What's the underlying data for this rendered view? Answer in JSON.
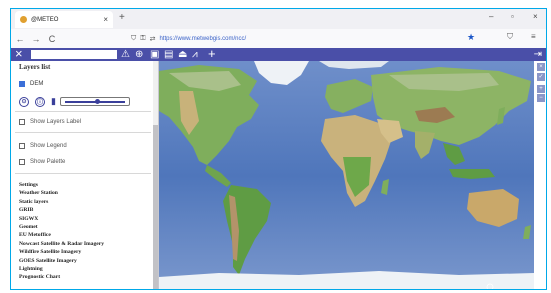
{
  "browser": {
    "tab_title": "@METEO",
    "tab_close": "×",
    "new_tab": "+",
    "nav": {
      "back": "←",
      "forward": "→",
      "reload": "C"
    },
    "url_icons": [
      "shield-icon",
      "lock-icon"
    ],
    "url": "https://www.metwebgis.com/ncc/",
    "window_controls": {
      "minimize": "–",
      "restore": "▫",
      "close": "×"
    },
    "right_icons": {
      "shield": "⛉",
      "menu": "≡"
    }
  },
  "app_toolbar": {
    "close": "×",
    "search_placeholder": "",
    "icons": [
      {
        "name": "alert-icon",
        "glyph": "⚠"
      },
      {
        "name": "globe-icon",
        "glyph": "⊕"
      },
      {
        "name": "window-icon",
        "glyph": "▣"
      },
      {
        "name": "clipboard-icon",
        "glyph": "▤"
      },
      {
        "name": "upload-icon",
        "glyph": "⏏"
      },
      {
        "name": "chart-icon",
        "glyph": "⩘"
      },
      {
        "name": "plus-icon",
        "glyph": "+"
      }
    ],
    "exit_icon": "⇥"
  },
  "side_panel": {
    "title": "Layers list",
    "layer": {
      "label": "DEM",
      "checked": true
    },
    "controls": {
      "up": "⊙",
      "info": "ⓘ",
      "delete": "🗑",
      "opacity": 0.55
    },
    "options": [
      {
        "label": "Show Layers Label",
        "checked": false
      },
      {
        "label": "Show Legend",
        "checked": false
      },
      {
        "label": "Show Palette",
        "checked": false
      }
    ],
    "menu": [
      "Settings",
      "Weather Station",
      "Static layers",
      "GRIB",
      "SIGWX",
      "Geomet",
      "EU Metoffice",
      "Nowcast Satellite & Radar Imagery",
      "Wildfire Satellite Imagery",
      "GOES Satellite Imagery",
      "Lightning",
      "Prognostic Chart"
    ]
  },
  "map_controls": {
    "close": "×",
    "check": "✓",
    "zoom_in": "+",
    "zoom_out": "−"
  },
  "colors": {
    "toolbar": "#4a4fa8",
    "ocean": "#5b7fc0",
    "land_low": "#7fae5c",
    "land_mid": "#c8b27a",
    "land_high": "#9c7b52",
    "ice": "#eef2f6",
    "accent": "#3a3f9a"
  }
}
